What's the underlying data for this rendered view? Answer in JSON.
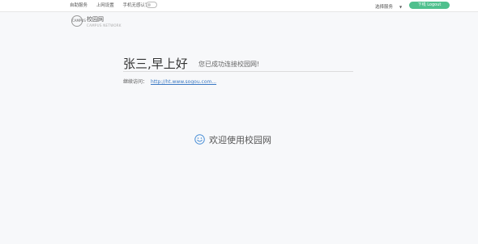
{
  "topbar": {
    "nav": [
      "自助服务",
      "上网设置",
      "手机无感认证"
    ],
    "service_select": "选择服务",
    "logout": "下线 Logout"
  },
  "brand": {
    "logo_text": "CAMPUS",
    "name": "校园网",
    "sub": "CAMPUS NETWORK"
  },
  "greeting": {
    "name": "张三,早上好",
    "message": "您已成功连接校园网!"
  },
  "continue": {
    "label": "继续访问：",
    "url": "http://ht.www.sogou.com..."
  },
  "welcome": {
    "text": "欢迎使用校园网"
  },
  "colors": {
    "accent": "#4fc08d",
    "link": "#3a78c3",
    "icon": "#4a8fd6"
  }
}
